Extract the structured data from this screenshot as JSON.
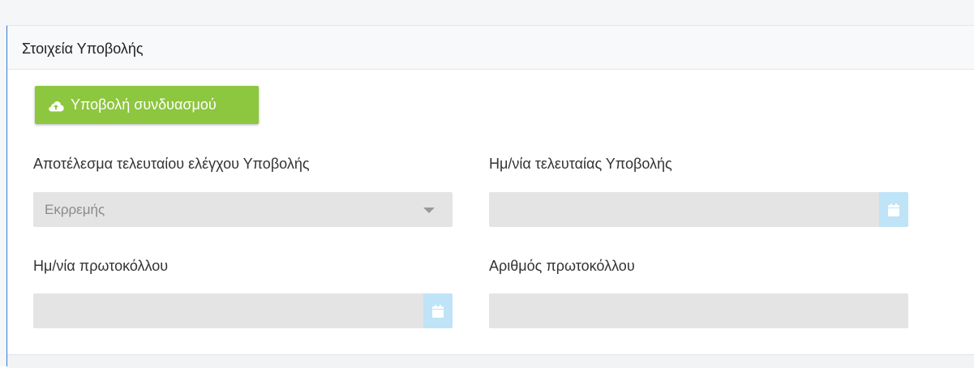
{
  "section": {
    "title": "Στοιχεία Υποβολής"
  },
  "submit_button": {
    "label": "Υποβολή συνδυασμού",
    "icon": "cloud-upload-icon",
    "color": "#8dc63f"
  },
  "fields": {
    "last_check_result": {
      "label": "Αποτέλεσμα τελευταίου ελέγχου Υποβολής",
      "value": "Εκρρεμής"
    },
    "last_submission_date": {
      "label": "Ημ/νία τελευταίας Υποβολής",
      "value": "",
      "icon": "calendar-icon"
    },
    "protocol_date": {
      "label": "Ημ/νία πρωτοκόλλου",
      "value": "",
      "icon": "calendar-icon"
    },
    "protocol_number": {
      "label": "Αριθμός πρωτοκόλλου",
      "value": ""
    }
  },
  "colors": {
    "accent_border": "#2d7fd3",
    "disabled_input": "#e4e4e4",
    "calendar_button": "#bfe3f7"
  }
}
